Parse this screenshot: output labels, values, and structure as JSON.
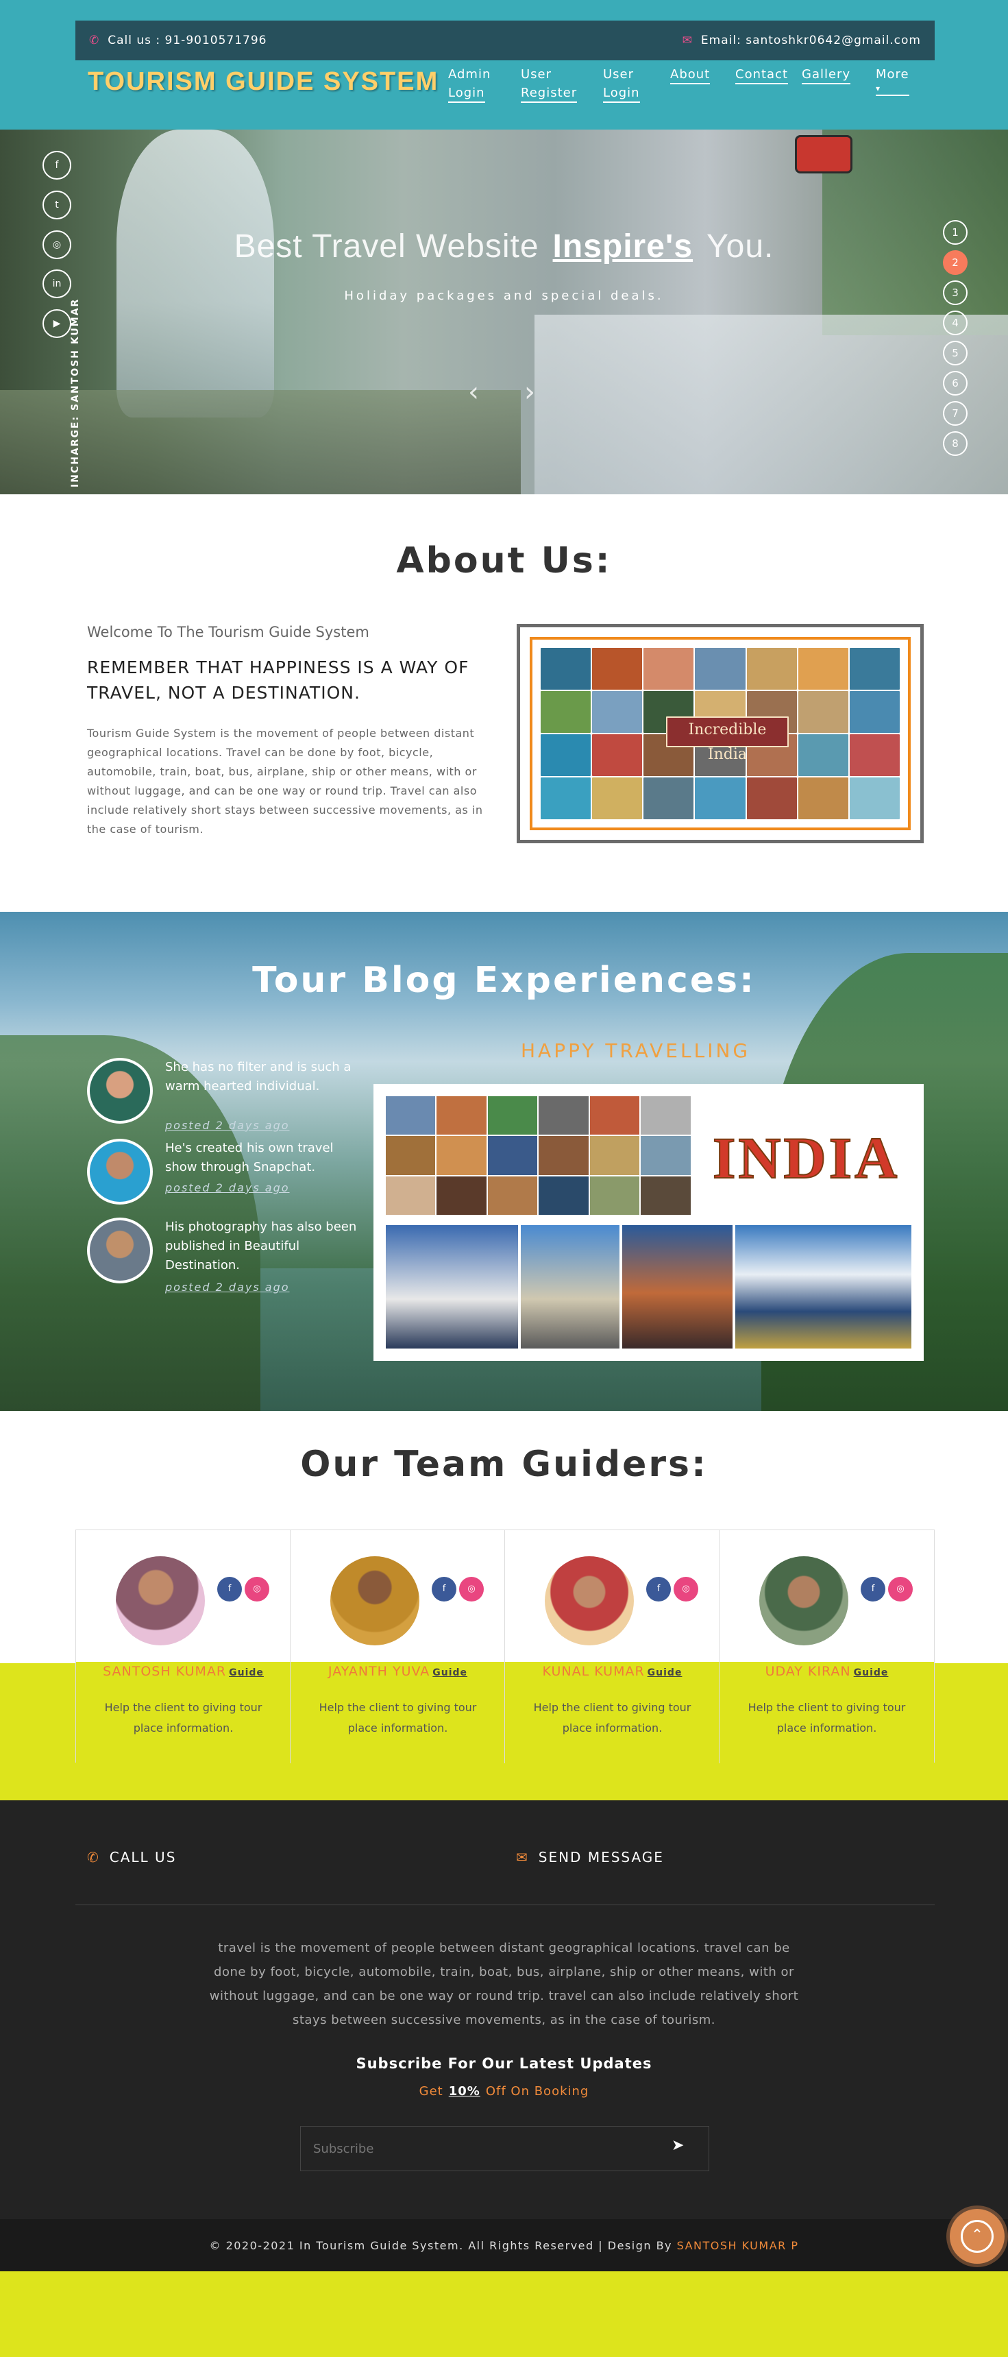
{
  "topbar": {
    "call": "Call us : 91-9010571796",
    "email": "Email: santoshkr0642@gmail.com"
  },
  "brand": "TOURISM GUIDE SYSTEM",
  "nav": {
    "admin": [
      "Admin",
      "Login"
    ],
    "user_register": [
      "User",
      "Register"
    ],
    "user_login": [
      "User",
      "Login"
    ],
    "about": "About",
    "contact": "Contact",
    "gallery": "Gallery",
    "more": "More"
  },
  "hero": {
    "headline_pre": "Best Travel Website",
    "headline_bold": "Inspire's",
    "headline_post": "You.",
    "sub": "Holiday packages and special deals.",
    "incharge": "INCHARGE: SANTOSH KUMAR",
    "social_icons": [
      "facebook-icon",
      "twitter-icon",
      "instagram-icon",
      "linkedin-icon",
      "youtube-icon"
    ],
    "slides": [
      "1",
      "2",
      "3",
      "4",
      "5",
      "6",
      "7",
      "8"
    ],
    "active_slide": "2"
  },
  "about": {
    "title": "About Us:",
    "welcome": "Welcome To The Tourism Guide System",
    "heading": "REMEMBER THAT HAPPINESS IS A WAY OF TRAVEL, NOT A DESTINATION.",
    "body": "Tourism Guide System is the movement of people between distant geographical locations. Travel can be done by foot, bicycle, automobile, train, boat, bus, airplane, ship or other means, with or without luggage, and can be one way or round trip. Travel can also include relatively short stays between successive movements, as in the case of tourism.",
    "image_banner": "Incredible India"
  },
  "blog": {
    "title": "Tour Blog Experiences:",
    "happy": "HAPPY TRAVELLING",
    "india_word": "INDIA",
    "posts": [
      {
        "text": "She has no filter and is such a warm hearted individual.",
        "when": "posted 2 days ago"
      },
      {
        "text": "He's created his own travel show through Snapchat.",
        "when": "posted 2 days ago"
      },
      {
        "text": "His photography has also been published in Beautiful Destination.",
        "when": "posted 2 days ago"
      }
    ]
  },
  "team": {
    "title": "Our Team Guiders:",
    "guide_label": "Guide",
    "members": [
      {
        "name": "SANTOSH KUMAR",
        "desc": "Help the client to giving tour place information."
      },
      {
        "name": "JAYANTH YUVA",
        "desc": "Help the client to giving tour place information."
      },
      {
        "name": "KUNAL KUMAR",
        "desc": "Help the client to giving tour place information."
      },
      {
        "name": "UDAY KIRAN",
        "desc": "Help the client to giving tour place information."
      }
    ]
  },
  "footer": {
    "call": "CALL US",
    "send": "SEND MESSAGE",
    "para": "travel is the movement of people between distant geographical locations. travel can be done by foot, bicycle, automobile, train, boat, bus, airplane, ship or other means, with or without luggage, and can be one way or round trip. travel can also include relatively short stays between successive movements, as in the case of tourism.",
    "subscribe_title": "Subscribe For Our Latest Updates",
    "get_pre": "Get",
    "get_pct": "10%",
    "get_post": "Off On Booking",
    "subscribe_placeholder": "Subscribe",
    "copyright": "© 2020-2021 In Tourism Guide System. All Rights Reserved | Design By",
    "designer": "SANTOSH KUMAR P"
  },
  "colors": {
    "header": "#3aacb8",
    "topbar": "#27505c",
    "brand": "#ffcf6a",
    "accent": "#f08a3a",
    "lime": "#dde41c",
    "footer": "#232323"
  }
}
